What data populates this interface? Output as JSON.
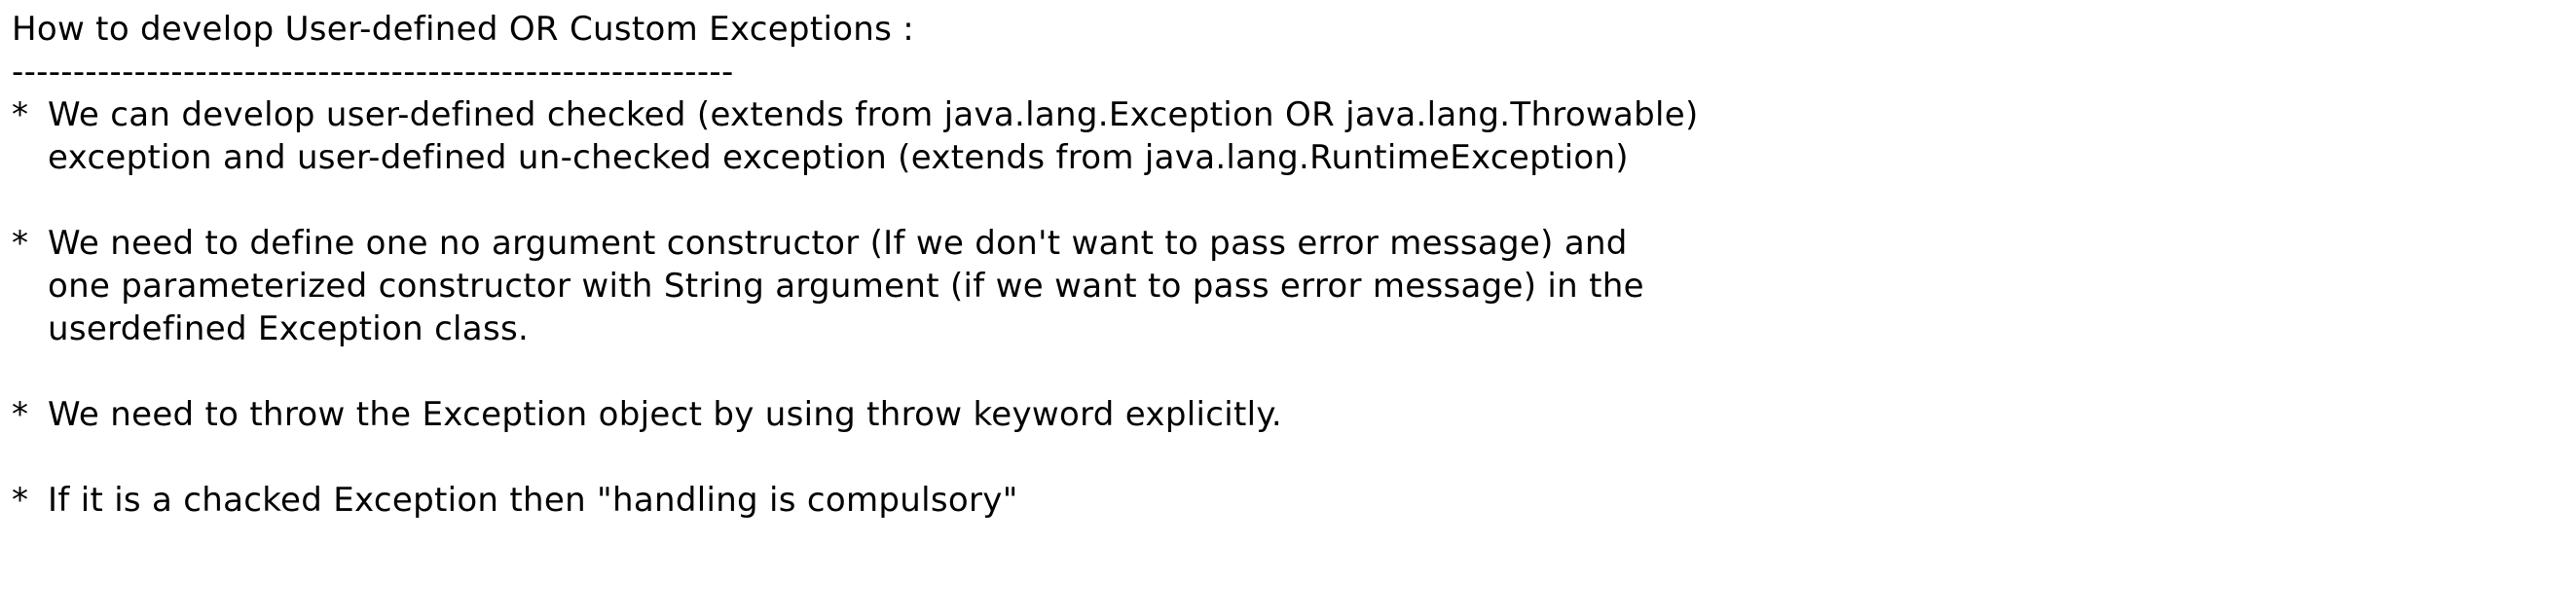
{
  "title": "How to develop User-defined OR Custom Exceptions :",
  "separator": "-----------------------------------------------------------",
  "bullets": [
    {
      "marker": "*",
      "lines": [
        "We can develop user-defined checked (extends from java.lang.Exception OR java.lang.Throwable)",
        "exception and user-defined un-checked exception (extends from java.lang.RuntimeException)"
      ]
    },
    {
      "marker": "*",
      "lines": [
        "We need to define one no argument constructor (If we don't want to pass error message) and",
        "one parameterized constructor with String argument (if we want to pass error message) in the",
        "userdefined Exception class."
      ]
    },
    {
      "marker": "*",
      "lines": [
        "We need to throw the Exception object by using throw keyword explicitly."
      ]
    },
    {
      "marker": "*",
      "lines": [
        "If it is a chacked Exception then \"handling is compulsory\""
      ]
    }
  ]
}
